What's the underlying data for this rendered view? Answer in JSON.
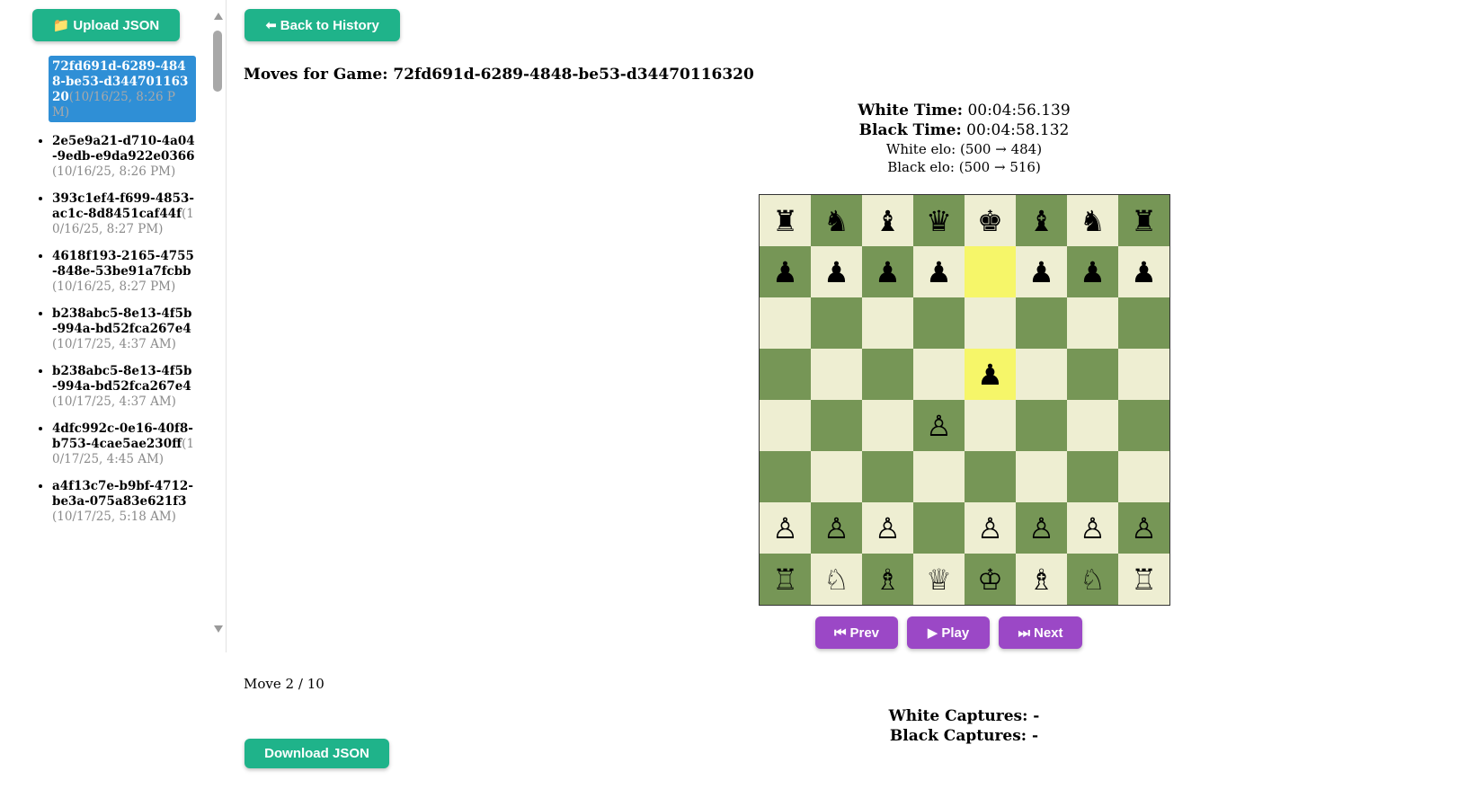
{
  "sidebar": {
    "upload_label": "Upload JSON",
    "upload_icon": "folder-icon",
    "games": [
      {
        "id": "72fd691d-6289-4848-be53-d34470116320",
        "date": "(10/16/25, 8:26 PM)",
        "active": true
      },
      {
        "id": "2e5e9a21-d710-4a04-9edb-e9da922e0366",
        "date": "(10/16/25, 8:26 PM)"
      },
      {
        "id": "393c1ef4-f699-4853-ac1c-8d8451caf44f",
        "date": "(10/16/25, 8:27 PM)"
      },
      {
        "id": "4618f193-2165-4755-848e-53be91a7fcbb",
        "date": "(10/16/25, 8:27 PM)"
      },
      {
        "id": "b238abc5-8e13-4f5b-994a-bd52fca267e4",
        "date": "(10/17/25, 4:37 AM)"
      },
      {
        "id": "b238abc5-8e13-4f5b-994a-bd52fca267e4",
        "date": "(10/17/25, 4:37 AM)"
      },
      {
        "id": "4dfc992c-0e16-40f8-b753-4cae5ae230ff",
        "date": "(10/17/25, 4:45 AM)"
      },
      {
        "id": "a4f13c7e-b9bf-4712-be3a-075a83e621f3",
        "date": "(10/17/25, 5:18 AM)"
      }
    ]
  },
  "header": {
    "back_label": "Back to History",
    "back_icon": "arrow-left-icon",
    "title": "Moves for Game: 72fd691d-6289-4848-be53-d34470116320"
  },
  "info": {
    "white_time_label": "White Time:",
    "white_time": "00:04:56.139",
    "black_time_label": "Black Time:",
    "black_time": "00:04:58.132",
    "white_elo": "White elo: (500 → 484)",
    "black_elo": "Black elo: (500 → 516)"
  },
  "board": {
    "rows": [
      [
        "r",
        "n",
        "b",
        "q",
        "k",
        "b",
        "n",
        "r"
      ],
      [
        "p",
        "p",
        "p",
        "p",
        "",
        "p",
        "p",
        "p"
      ],
      [
        "",
        "",
        "",
        "",
        "",
        "",
        "",
        ""
      ],
      [
        "",
        "",
        "",
        "",
        "p",
        "",
        "",
        ""
      ],
      [
        "",
        "",
        "",
        "P",
        "",
        "",
        "",
        ""
      ],
      [
        "",
        "",
        "",
        "",
        "",
        "",
        "",
        ""
      ],
      [
        "P",
        "P",
        "P",
        "",
        "P",
        "P",
        "P",
        "P"
      ],
      [
        "R",
        "N",
        "B",
        "Q",
        "K",
        "B",
        "N",
        "R"
      ]
    ],
    "highlights": [
      [
        1,
        4
      ],
      [
        3,
        4
      ]
    ],
    "light_color": "#eeeed2",
    "dark_color": "#769656",
    "highlight_color": "#f6f669"
  },
  "controls": {
    "prev_label": "Prev",
    "play_label": "Play",
    "next_label": "Next",
    "prev_icon": "skip-back-icon",
    "play_icon": "play-icon",
    "next_icon": "skip-forward-icon"
  },
  "move_counter": {
    "label": "Move",
    "current": "2",
    "separator": "/",
    "total": "10"
  },
  "captures": {
    "white": "White Captures: -",
    "black": "Black Captures: -"
  },
  "footer": {
    "download_label": "Download JSON"
  },
  "colors": {
    "teal": "#1fb38a",
    "purple": "#9b48c6",
    "active_item": "#2f8fd6"
  }
}
